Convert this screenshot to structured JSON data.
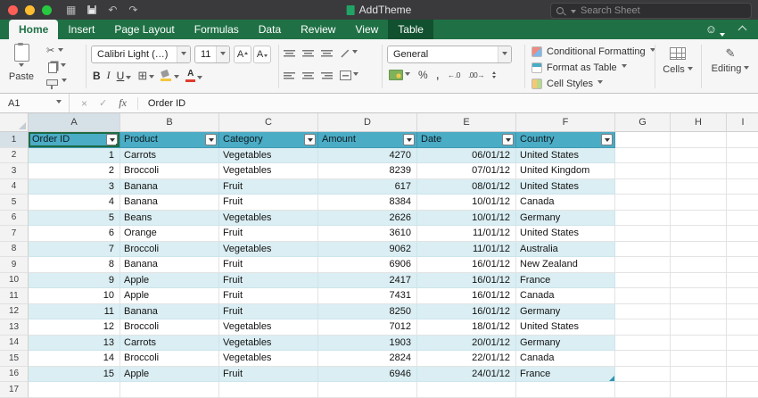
{
  "titlebar": {
    "title": "AddTheme",
    "search_placeholder": "Search Sheet"
  },
  "ribbon_tabs": [
    {
      "label": "Home",
      "state": "active"
    },
    {
      "label": "Insert"
    },
    {
      "label": "Page Layout"
    },
    {
      "label": "Formulas"
    },
    {
      "label": "Data"
    },
    {
      "label": "Review"
    },
    {
      "label": "View"
    },
    {
      "label": "Table",
      "state": "contextual"
    }
  ],
  "ribbon": {
    "paste_label": "Paste",
    "font_name": "Calibri Light (…)",
    "font_size": "11",
    "font_letter": "A",
    "bold": "B",
    "italic": "I",
    "underline": "U",
    "number_format": "General",
    "styles": {
      "conditional_formatting": "Conditional Formatting",
      "format_as_table": "Format as Table",
      "cell_styles": "Cell Styles"
    },
    "cells_label": "Cells",
    "editing_label": "Editing"
  },
  "icons": {
    "scissors": "✂",
    "grid": "▦",
    "undo": "↶",
    "redo": "↷",
    "cancel": "×",
    "confirm": "✓",
    "smiley": "☺",
    "borders": "⊞",
    "pencil": "✎",
    "percent": "%",
    "comma": ",",
    "decrease_decimal": "←.0",
    "increase_decimal": ".00→"
  },
  "formula_bar": {
    "name_box": "A1",
    "fx_label": "fx",
    "content": "Order ID"
  },
  "grid": {
    "column_headers": [
      "A",
      "B",
      "C",
      "D",
      "E",
      "F",
      "G",
      "H",
      "I"
    ],
    "row_numbers": [
      "1",
      "2",
      "3",
      "4",
      "5",
      "6",
      "7",
      "8",
      "9",
      "10",
      "11",
      "12",
      "13",
      "14",
      "15",
      "16",
      "17"
    ],
    "selected_cell": "A1"
  },
  "table": {
    "headers": [
      "Order ID",
      "Product",
      "Category",
      "Amount",
      "Date",
      "Country"
    ],
    "rows": [
      [
        "1",
        "Carrots",
        "Vegetables",
        "4270",
        "06/01/12",
        "United States"
      ],
      [
        "2",
        "Broccoli",
        "Vegetables",
        "8239",
        "07/01/12",
        "United Kingdom"
      ],
      [
        "3",
        "Banana",
        "Fruit",
        "617",
        "08/01/12",
        "United States"
      ],
      [
        "4",
        "Banana",
        "Fruit",
        "8384",
        "10/01/12",
        "Canada"
      ],
      [
        "5",
        "Beans",
        "Vegetables",
        "2626",
        "10/01/12",
        "Germany"
      ],
      [
        "6",
        "Orange",
        "Fruit",
        "3610",
        "11/01/12",
        "United States"
      ],
      [
        "7",
        "Broccoli",
        "Vegetables",
        "9062",
        "11/01/12",
        "Australia"
      ],
      [
        "8",
        "Banana",
        "Fruit",
        "6906",
        "16/01/12",
        "New Zealand"
      ],
      [
        "9",
        "Apple",
        "Fruit",
        "2417",
        "16/01/12",
        "France"
      ],
      [
        "10",
        "Apple",
        "Fruit",
        "7431",
        "16/01/12",
        "Canada"
      ],
      [
        "11",
        "Banana",
        "Fruit",
        "8250",
        "16/01/12",
        "Germany"
      ],
      [
        "12",
        "Broccoli",
        "Vegetables",
        "7012",
        "18/01/12",
        "United States"
      ],
      [
        "13",
        "Carrots",
        "Vegetables",
        "1903",
        "20/01/12",
        "Germany"
      ],
      [
        "14",
        "Broccoli",
        "Vegetables",
        "2824",
        "22/01/12",
        "Canada"
      ],
      [
        "15",
        "Apple",
        "Fruit",
        "6946",
        "24/01/12",
        "France"
      ]
    ]
  },
  "colors": {
    "excel_green": "#1F7145",
    "table_header": "#4BACC6",
    "band": "#DAEEF3",
    "selection": "#1D6B44"
  }
}
